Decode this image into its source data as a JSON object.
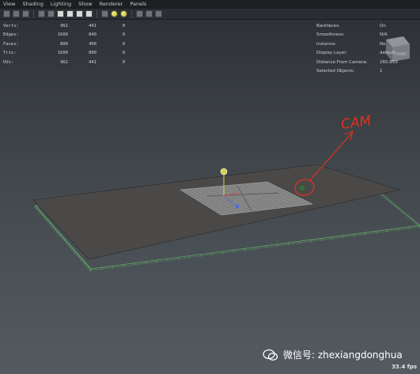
{
  "menu": [
    "View",
    "Shading",
    "Lighting",
    "Show",
    "Renderer",
    "Panels"
  ],
  "toolbar_icons": [
    "camera-icon",
    "shelf-icon",
    "grid-icon",
    "film-gate-icon",
    "resolution-icon",
    "cube-icon",
    "wireframe-icon",
    "smooth-shade-icon",
    "textured-icon",
    "light-icon",
    "sphere-icon",
    "sphere-icon",
    "xray-icon",
    "isolate-icon",
    "sync-icon"
  ],
  "hud_left": [
    {
      "label": "Verts:",
      "c1": "962",
      "c2": "441",
      "c3": "0"
    },
    {
      "label": "Edges:",
      "c1": "1600",
      "c2": "840",
      "c3": "0"
    },
    {
      "label": "Faces:",
      "c1": "800",
      "c2": "400",
      "c3": "0"
    },
    {
      "label": "Tris:",
      "c1": "1600",
      "c2": "800",
      "c3": "0"
    },
    {
      "label": "UVs:",
      "c1": "962",
      "c2": "441",
      "c3": "0"
    }
  ],
  "hud_right": [
    {
      "label": "Backfaces:",
      "value": "On"
    },
    {
      "label": "Smoothness:",
      "value": "N/A"
    },
    {
      "label": "Instance:",
      "value": "No"
    },
    {
      "label": "Display Layer:",
      "value": "default"
    },
    {
      "label": "Distance From Camera:",
      "value": "160.853"
    },
    {
      "label": "Selected Objects:",
      "value": "1"
    }
  ],
  "annotation": "CAM",
  "view_cube": "FRONT",
  "fps": "33.4 fps",
  "watermark": "微信号: zhexiangdonghua",
  "colors": {
    "annotation": "#e0321e",
    "grid": "#6fd36f",
    "plane": "#4a4948"
  }
}
